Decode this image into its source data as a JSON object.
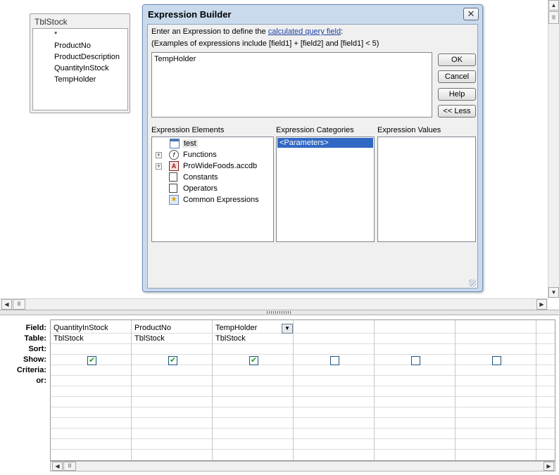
{
  "table": {
    "title": "TblStock",
    "fields": [
      "*",
      "ProductNo",
      "ProductDescription",
      "QuantityInStock",
      "TempHolder"
    ]
  },
  "grid": {
    "row_labels": [
      "Field:",
      "Table:",
      "Sort:",
      "Show:",
      "Criteria:",
      "or:"
    ],
    "columns": [
      {
        "field": "QuantityInStock",
        "table": "TblStock",
        "show": true
      },
      {
        "field": "ProductNo",
        "table": "TblStock",
        "show": true
      },
      {
        "field": "TempHolder",
        "table": "TblStock",
        "show": true
      },
      {
        "field": "",
        "table": "",
        "show": false
      },
      {
        "field": "",
        "table": "",
        "show": false
      },
      {
        "field": "",
        "table": "",
        "show": false
      }
    ]
  },
  "dialog": {
    "title": "Expression Builder",
    "close_glyph": "✕",
    "prompt_prefix": "Enter an Expression to define the ",
    "prompt_link": "calculated query field",
    "prompt_suffix": ":",
    "examples": "(Examples of expressions include [field1] + [field2] and [field1] < 5)",
    "expression": "TempHolder",
    "buttons": {
      "ok": "OK",
      "cancel": "Cancel",
      "help": "Help",
      "less": "<< Less"
    },
    "elements_header": "Expression Elements",
    "categories_header": "Expression Categories",
    "values_header": "Expression Values",
    "elements": [
      {
        "label": "test",
        "expandable": false,
        "icon": "query-icon"
      },
      {
        "label": "Functions",
        "expandable": true,
        "icon": "function-icon"
      },
      {
        "label": "ProWideFoods.accdb",
        "expandable": true,
        "icon": "database-icon"
      },
      {
        "label": "Constants",
        "expandable": false,
        "icon": "constants-icon"
      },
      {
        "label": "Operators",
        "expandable": false,
        "icon": "operators-icon"
      },
      {
        "label": "Common Expressions",
        "expandable": false,
        "icon": "common-expressions-icon"
      }
    ],
    "categories": [
      "<Parameters>"
    ]
  },
  "scroll_glyphs": {
    "up": "▲",
    "down": "▼",
    "left": "◀",
    "right": "▶",
    "grip": "|||"
  },
  "colors": {
    "selection": "#3168c4",
    "dialog_frame": "#c9daed",
    "check": "#21a121"
  }
}
